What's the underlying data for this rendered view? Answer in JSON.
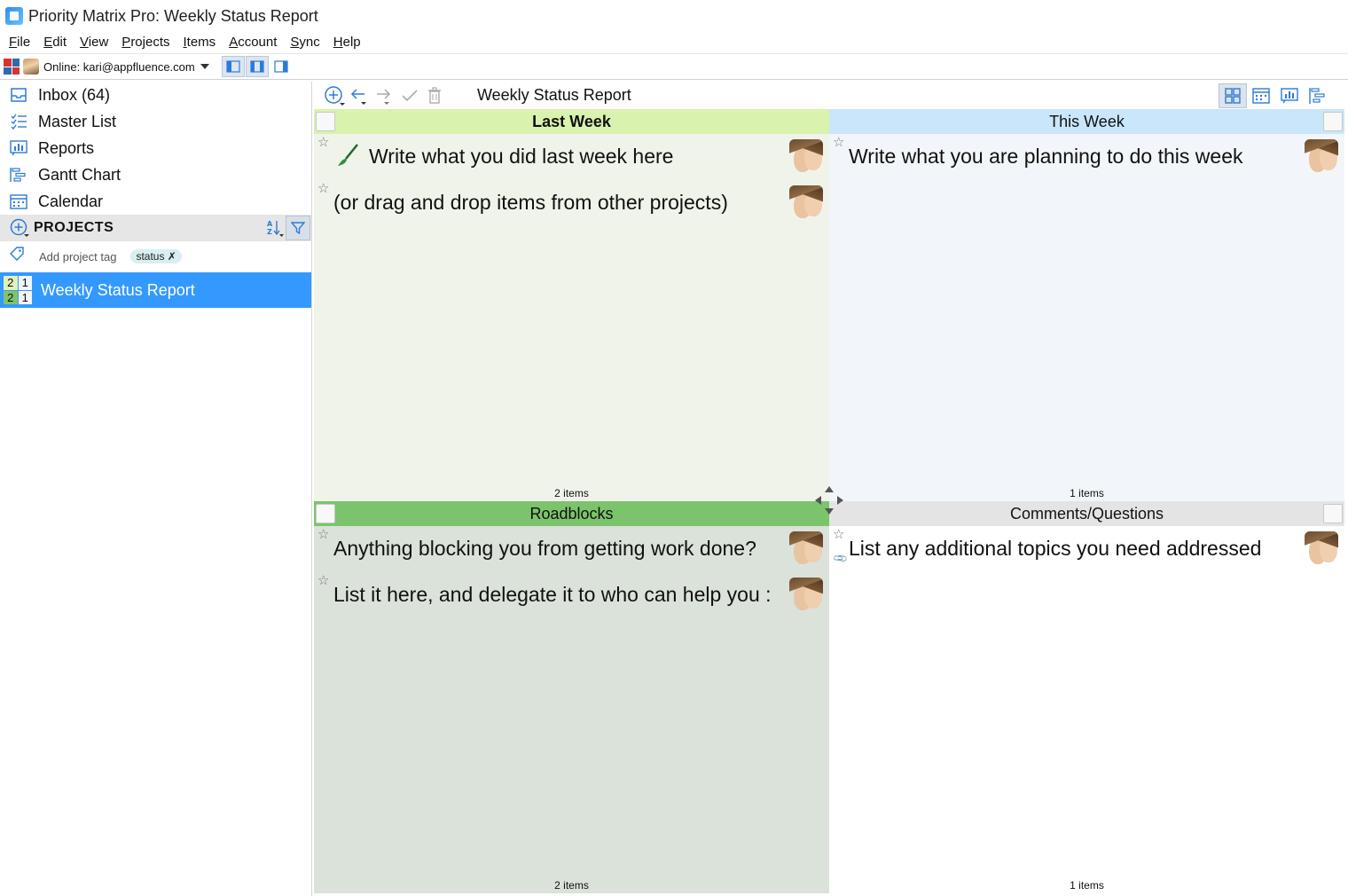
{
  "window": {
    "title": "Priority Matrix Pro: Weekly Status Report"
  },
  "menu": [
    "File",
    "Edit",
    "View",
    "Projects",
    "Items",
    "Account",
    "Sync",
    "Help"
  ],
  "toolbar": {
    "online_text": "Online: kari@appfluence.com"
  },
  "sidebar": {
    "nav": [
      {
        "label": "Inbox (64)",
        "icon": "inbox-icon"
      },
      {
        "label": "Master List",
        "icon": "list-icon"
      },
      {
        "label": "Reports",
        "icon": "reports-icon"
      },
      {
        "label": "Gantt Chart",
        "icon": "gantt-icon"
      },
      {
        "label": "Calendar",
        "icon": "calendar-icon"
      }
    ],
    "projects_header": "PROJECTS",
    "add_tag_label": "Add project tag",
    "tag_chip": "status ✗",
    "project": {
      "name": "Weekly Status Report",
      "matrix": [
        "2",
        "1",
        "2",
        "1"
      ]
    }
  },
  "main": {
    "title": "Weekly Status Report",
    "quadrants": [
      {
        "title": "Last Week",
        "header_color": "#d9f2ae",
        "body_color": "#f0f3ea",
        "items": [
          "Write what you did last week here",
          "(or drag and drop items from other projects)"
        ],
        "count": "2 items"
      },
      {
        "title": "This Week",
        "header_color": "#c9e6fb",
        "body_color": "#f2f6fa",
        "items": [
          "Write what you are planning to do this week"
        ],
        "count": "1 items"
      },
      {
        "title": "Roadblocks",
        "header_color": "#7bc46c",
        "body_color": "#dbe2da",
        "items": [
          "Anything blocking you from getting work done?",
          "List it here, and delegate it to who can help you :"
        ],
        "count": "2 items"
      },
      {
        "title": "Comments/Questions",
        "header_color": "#e4e4e4",
        "body_color": "#ffffff",
        "items": [
          "List any additional topics you need addressed"
        ],
        "count": "1 items"
      }
    ]
  },
  "colors": {
    "selected_project": "#3399ff",
    "accent_icon": "#2d7bd6"
  }
}
